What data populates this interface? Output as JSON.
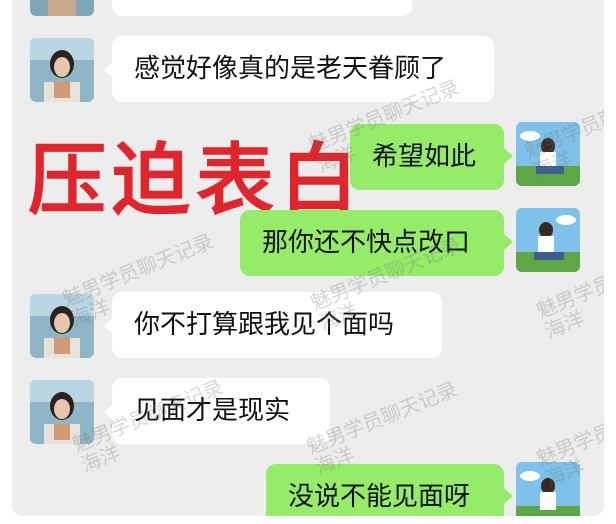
{
  "messages": [
    {
      "side": "left",
      "text": "感觉好像真的是老天眷顾了"
    },
    {
      "side": "right",
      "text": "希望如此"
    },
    {
      "side": "right",
      "text": "那你还不快点改口"
    },
    {
      "side": "left",
      "text": "你不打算跟我见个面吗"
    },
    {
      "side": "left",
      "text": "见面才是现实"
    },
    {
      "side": "right",
      "text": "没说不能见面呀"
    }
  ],
  "overlay": {
    "label": "压迫表白"
  },
  "watermark": {
    "line1": "魅男学员聊天记录",
    "line2": "海洋"
  },
  "colors": {
    "outgoing_bubble": "#95ec69",
    "incoming_bubble": "#ffffff",
    "background": "#ededed",
    "overlay_text": "#e0252c"
  }
}
